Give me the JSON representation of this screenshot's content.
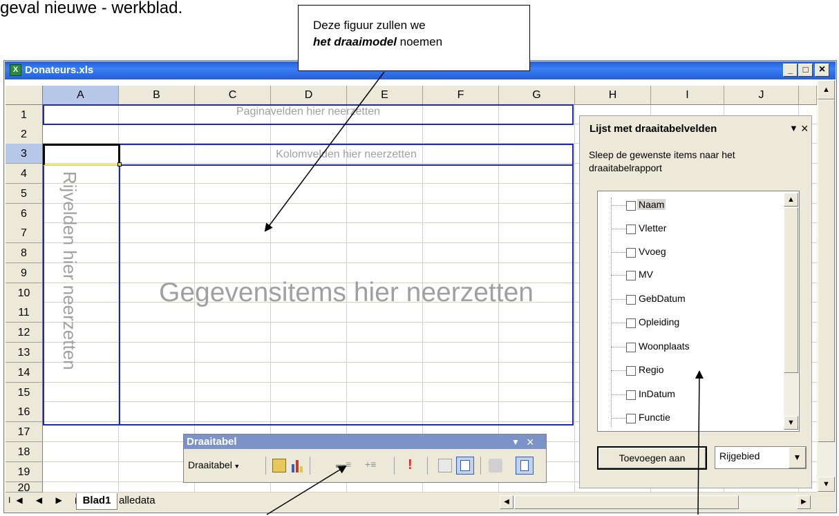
{
  "intro_text": "geval nieuwe - werkblad.",
  "callout": {
    "line1": "Deze figuur zullen we",
    "bold": "het draaimodel",
    "rest": " noemen"
  },
  "window": {
    "title": "Donateurs.xls",
    "minimize": "_",
    "maximize": "□",
    "close": "×"
  },
  "columns": [
    "A",
    "B",
    "C",
    "D",
    "E",
    "F",
    "G",
    "H",
    "I",
    "J"
  ],
  "rows": [
    "1",
    "2",
    "3",
    "4",
    "5",
    "6",
    "7",
    "8",
    "9",
    "10",
    "11",
    "12",
    "13",
    "14",
    "15",
    "16",
    "17",
    "18",
    "19",
    "20"
  ],
  "drop_zones": {
    "page": "Paginavelden hier neerzetten",
    "column": "Kolomvelden hier neerzetten",
    "row": "Rijvelden hier neerzetten",
    "data": "Gegevensitems hier neerzetten"
  },
  "field_list": {
    "title": "Lijst met draaitabelvelden",
    "instructions_line1": "Sleep de gewenste items naar het",
    "instructions_line2": "draaitabelrapport",
    "fields": [
      "Naam",
      "Vletter",
      "Vvoeg",
      "MV",
      "GebDatum",
      "Opleiding",
      "Woonplaats",
      "Regio",
      "InDatum",
      "Functie"
    ],
    "add_button": "Toevoegen aan",
    "area_select": "Rijgebied"
  },
  "toolbar": {
    "title": "Draaitabel",
    "menu": "Draaitabel"
  },
  "sheet_tabs": [
    "Blad1",
    "alledata"
  ]
}
